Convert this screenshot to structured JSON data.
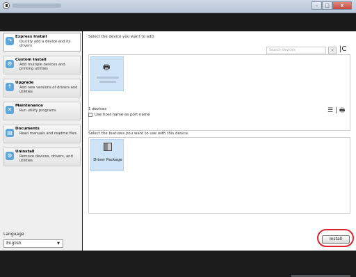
{
  "window": {
    "minimize_glyph": "–",
    "maximize_glyph": "□",
    "close_glyph": "x"
  },
  "sidebar": {
    "items": [
      {
        "title": "Express Install",
        "description": "Quickly add a device and its drivers",
        "icon": "express-install-icon"
      },
      {
        "title": "Custom Install",
        "description": "Add multiple devices and printing utilities",
        "icon": "custom-install-icon"
      },
      {
        "title": "Upgrade",
        "description": "Add new versions of drivers and utilities",
        "icon": "upgrade-icon"
      },
      {
        "title": "Maintenance",
        "description": "Run utility programs",
        "icon": "maintenance-icon"
      },
      {
        "title": "Documents",
        "description": "Read manuals and readme files",
        "icon": "documents-icon"
      },
      {
        "title": "Uninstall",
        "description": "Remove devices, drivers, and utilities",
        "icon": "uninstall-icon"
      }
    ],
    "language_label": "Language",
    "language_value": "English",
    "language_arrow": "▼"
  },
  "main": {
    "device_prompt": "Select the device you want to add.",
    "search_placeholder": "Search devices",
    "clear_glyph": "×",
    "refresh_glyph": "|C",
    "device_icon_glyph": "🖶",
    "devices_count": "1 devices",
    "host_name_label": "Use host name as port name",
    "view_glyph": "☰ | 🖶",
    "features_prompt": "Select the features you want to use with this device.",
    "feature_label": "Driver Package",
    "install_label": "Install"
  },
  "colors": {
    "highlight": "#e0202a",
    "tile_selected": "#cfe4f7"
  }
}
